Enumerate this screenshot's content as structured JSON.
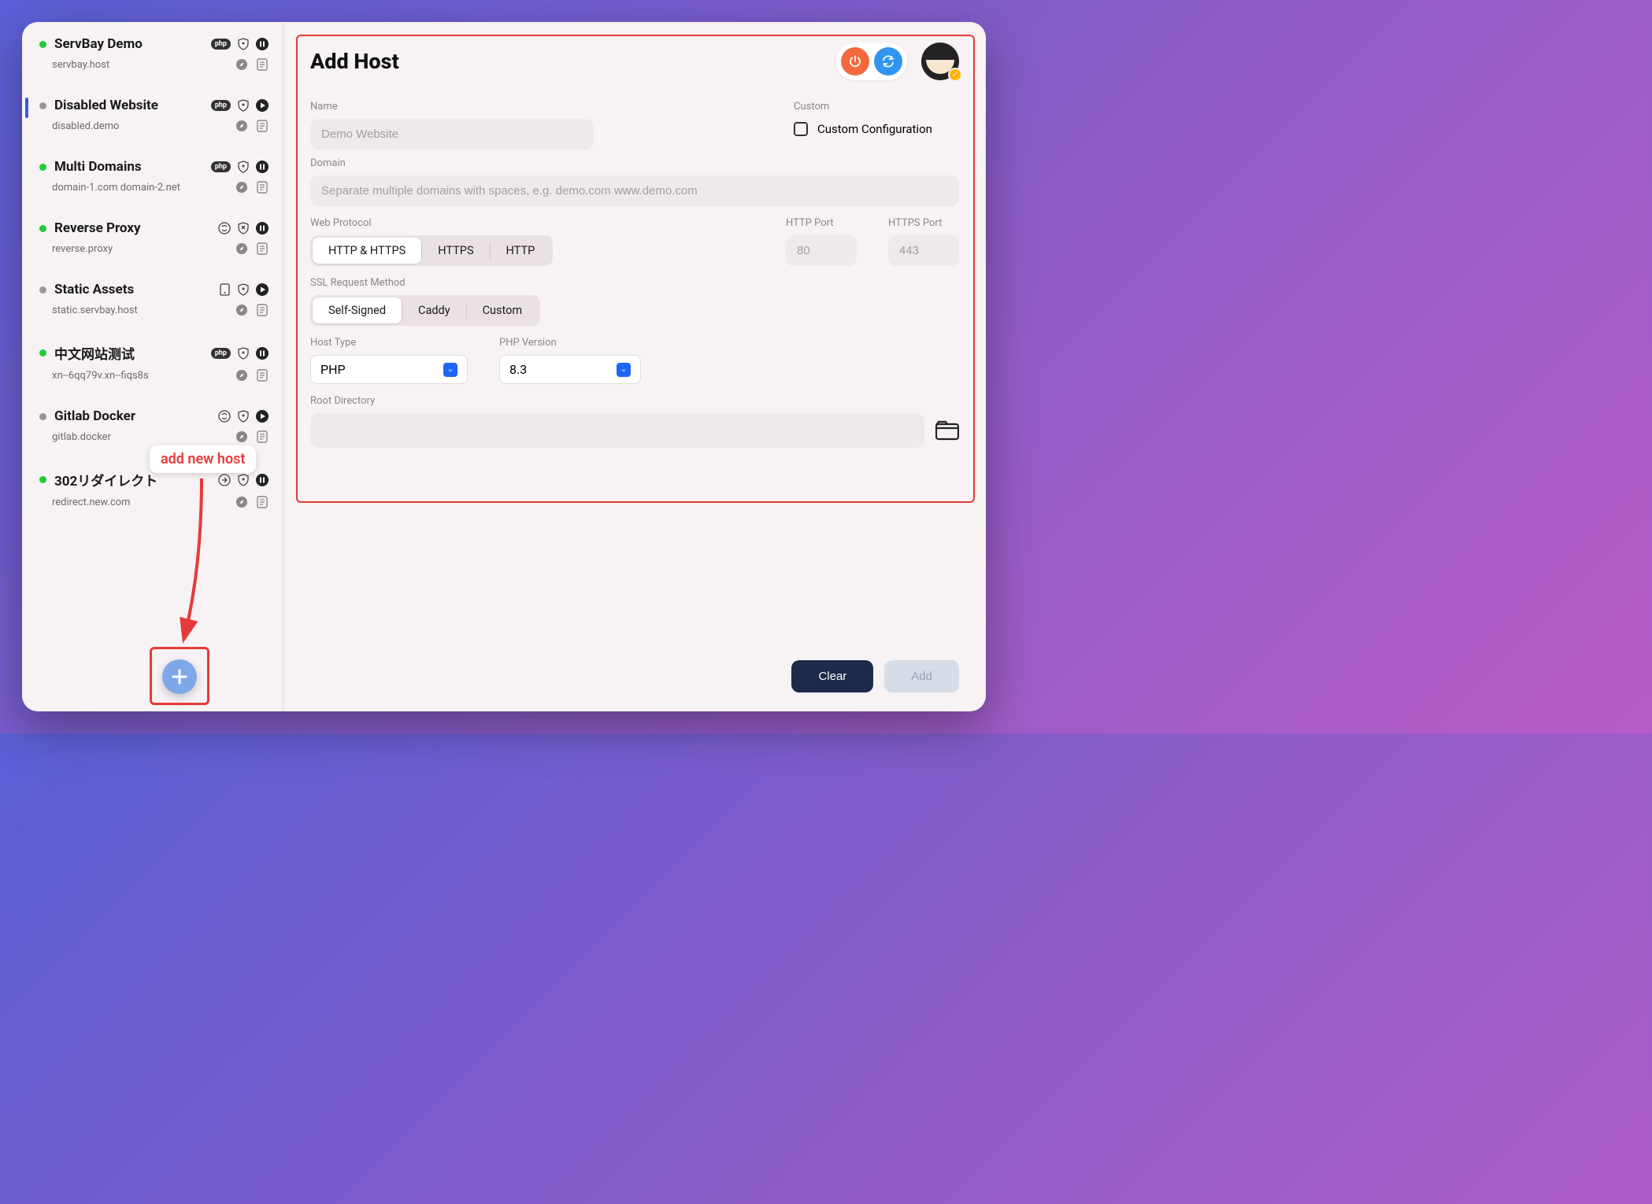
{
  "sidebar": {
    "hosts": [
      {
        "status": "green",
        "name": "ServBay Demo",
        "domain": "servbay.host",
        "badge": "php",
        "icons": [
          "shield",
          "pause"
        ],
        "row2icons": [
          "compass",
          "note"
        ]
      },
      {
        "status": "gray",
        "name": "Disabled Website",
        "domain": "disabled.demo",
        "badge": "php",
        "icons": [
          "shield",
          "play"
        ],
        "row2icons": [
          "compass",
          "note"
        ],
        "selected": true
      },
      {
        "status": "green",
        "name": "Multi Domains",
        "domain": "domain-1.com domain-2.net",
        "badge": "php",
        "icons": [
          "shield",
          "pause"
        ],
        "row2icons": [
          "compass",
          "note"
        ]
      },
      {
        "status": "green",
        "name": "Reverse Proxy",
        "domain": "reverse.proxy",
        "badge": "cycle",
        "icons": [
          "shieldx",
          "pause"
        ],
        "row2icons": [
          "compass",
          "note"
        ]
      },
      {
        "status": "gray",
        "name": "Static Assets",
        "domain": "static.servbay.host",
        "badge": "static",
        "icons": [
          "shield",
          "play"
        ],
        "row2icons": [
          "compass",
          "note"
        ]
      },
      {
        "status": "green",
        "name": "中文网站测试",
        "domain": "xn--6qq79v.xn--fiqs8s",
        "badge": "php",
        "icons": [
          "shield",
          "pause"
        ],
        "row2icons": [
          "compass",
          "note"
        ]
      },
      {
        "status": "gray",
        "name": "Gitlab Docker",
        "domain": "gitlab.docker",
        "badge": "cycle",
        "icons": [
          "shield",
          "play"
        ],
        "row2icons": [
          "compass",
          "note"
        ]
      },
      {
        "status": "green",
        "name": "302リダイレクト",
        "domain": "redirect.new.com",
        "badge": "redirect",
        "icons": [
          "shield",
          "pause"
        ],
        "row2icons": [
          "compass",
          "note"
        ]
      }
    ]
  },
  "callout": "add new host",
  "main": {
    "title": "Add Host",
    "labels": {
      "name": "Name",
      "custom": "Custom",
      "custom_config": "Custom Configuration",
      "domain": "Domain",
      "web_protocol": "Web Protocol",
      "http_port": "HTTP Port",
      "https_port": "HTTPS Port",
      "ssl": "SSL Request Method",
      "host_type": "Host Type",
      "php_version": "PHP Version",
      "root_dir": "Root Directory"
    },
    "placeholders": {
      "name": "Demo Website",
      "domain": "Separate multiple domains with spaces, e.g. demo.com www.demo.com",
      "http_port": "80",
      "https_port": "443"
    },
    "protocol_options": [
      "HTTP & HTTPS",
      "HTTPS",
      "HTTP"
    ],
    "protocol_selected": 0,
    "ssl_options": [
      "Self-Signed",
      "Caddy",
      "Custom"
    ],
    "ssl_selected": 0,
    "host_type_value": "PHP",
    "php_version_value": "8.3"
  },
  "footer": {
    "clear": "Clear",
    "add": "Add"
  }
}
